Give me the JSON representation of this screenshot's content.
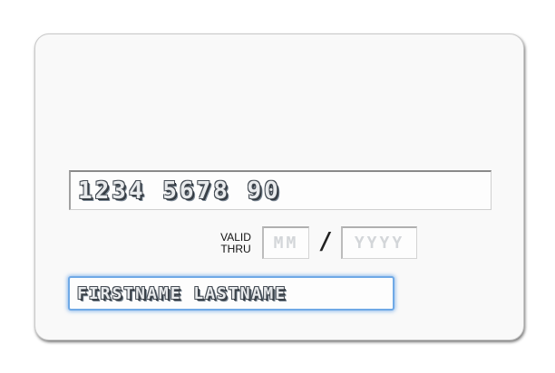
{
  "card": {
    "number": "1234 5678 90",
    "valid_label_line1": "VALID",
    "valid_label_line2": "THRU",
    "exp_month_placeholder": "MM",
    "exp_separator": "/",
    "exp_year_placeholder": "YYYY",
    "name": "FIRSTNAME LASTNAME"
  },
  "colors": {
    "card_background": "#f9f9f9",
    "focus_ring": "#6fa9e6",
    "embossed_text": "#444b53",
    "placeholder_text": "#d3d6d9"
  }
}
